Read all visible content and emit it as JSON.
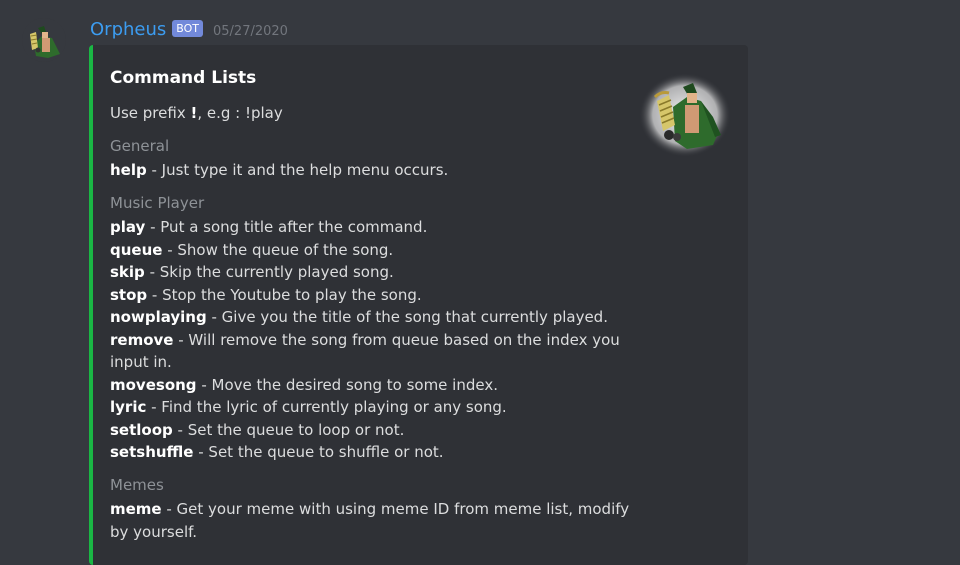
{
  "message": {
    "username": "Orpheus",
    "bot_tag": "BOT",
    "timestamp": "05/27/2020",
    "avatar_icon": "orpheus-avatar-icon"
  },
  "embed": {
    "accent_color": "#1ab744",
    "title": "Command Lists",
    "description": {
      "prefix_text": "Use prefix ",
      "prefix_symbol": "!",
      "suffix_text": ", e.g : !play"
    },
    "thumbnail_icon": "orpheus-thumbnail-icon",
    "fields": [
      {
        "name": "General",
        "commands": [
          {
            "cmd": "help",
            "desc": " - Just type it and the help menu occurs."
          }
        ]
      },
      {
        "name": "Music Player",
        "commands": [
          {
            "cmd": "play",
            "desc": " - Put a song title after the command."
          },
          {
            "cmd": "queue",
            "desc": " - Show the queue of the song."
          },
          {
            "cmd": "skip",
            "desc": " - Skip the currently played song."
          },
          {
            "cmd": "stop",
            "desc": " - Stop the Youtube to play the song."
          },
          {
            "cmd": "nowplaying",
            "desc": " - Give you the title of the song that currently played."
          },
          {
            "cmd": "remove",
            "desc": " - Will remove the song from queue based on the index you input in."
          },
          {
            "cmd": "movesong",
            "desc": " - Move the desired song to some index."
          },
          {
            "cmd": "lyric",
            "desc": " - Find the lyric of currently playing or any song."
          },
          {
            "cmd": "setloop",
            "desc": " - Set the queue to loop or not."
          },
          {
            "cmd": "setshuffle",
            "desc": " - Set the queue to shuffle or not."
          }
        ]
      },
      {
        "name": "Memes",
        "commands": [
          {
            "cmd": "meme",
            "desc": " - Get your meme with using meme ID from meme list, modify by yourself."
          }
        ]
      }
    ]
  }
}
